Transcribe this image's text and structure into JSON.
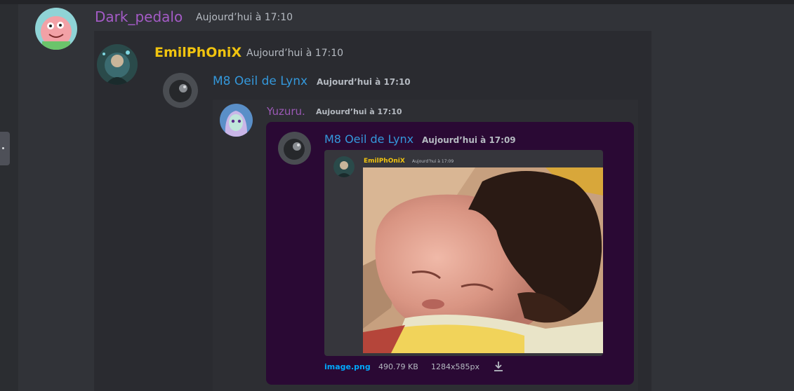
{
  "messages": [
    {
      "author": "Dark_pedalo",
      "timestamp": "Aujourd’hui à 17:10",
      "author_color": "#a45bc6"
    },
    {
      "author": "EmilPhOniX",
      "timestamp": "Aujourd’hui à 17:10",
      "author_color": "#f1c40f"
    },
    {
      "author": "M8 Oeil de Lynx",
      "timestamp": "Aujourd’hui à 17:10",
      "author_color": "#3498db"
    },
    {
      "author": "Yuzuru.",
      "timestamp": "Aujourd’hui à 17:10",
      "author_color": "#9b59b6"
    },
    {
      "author": "M8 Oeil de Lynx",
      "timestamp": "Aujourd’hui à 17:09",
      "author_color": "#3498db"
    },
    {
      "author": "EmilPhOniX",
      "timestamp": "Aujourd’hui à 17:09",
      "author_color": "#f1c40f"
    }
  ],
  "attachment": {
    "filename": "image.png",
    "size": "490.79 KB",
    "dimensions": "1284x585px",
    "download_icon": "download-icon"
  },
  "colors": {
    "background": "#313338",
    "embed_purple": "#2a0934",
    "link": "#00a8fc"
  }
}
